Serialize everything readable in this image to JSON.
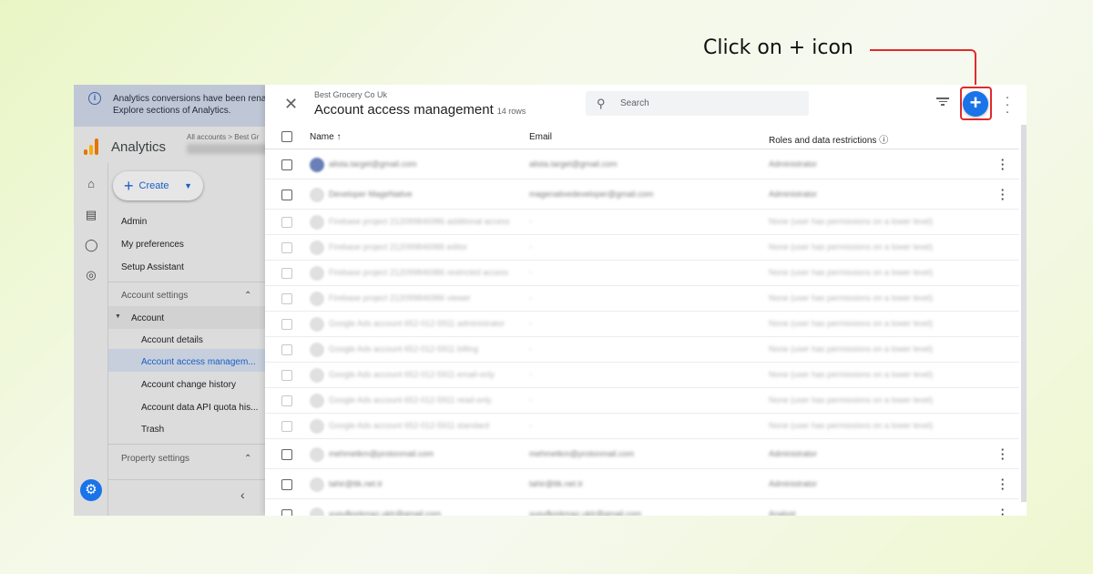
{
  "callout": {
    "text": "Click on + icon",
    "accent": "#e02b2b"
  },
  "ga": {
    "banner_line1": "Analytics conversions have been renam",
    "banner_line2": "Explore sections of Analytics.",
    "brand": "Analytics",
    "breadcrumb": "All accounts > Best Gr",
    "create_label": "Create",
    "nav": {
      "admin": "Admin",
      "my_preferences": "My preferences",
      "setup_assistant": "Setup Assistant",
      "account_settings": "Account settings",
      "account": "Account",
      "account_details": "Account details",
      "account_access": "Account access managem...",
      "account_change_history": "Account change history",
      "account_data_api": "Account data API quota his...",
      "trash": "Trash",
      "property_settings": "Property settings"
    },
    "rail_icons": [
      "home-icon",
      "reports-icon",
      "explore-icon",
      "advertising-icon"
    ],
    "settings_icon": "gear-icon"
  },
  "panel": {
    "account_name": "Best Grocery Co Uk",
    "title": "Account access management",
    "row_count": "14 rows",
    "search_placeholder": "Search",
    "columns": {
      "name": "Name",
      "email": "Email",
      "roles": "Roles and data restrictions"
    },
    "accent": "#1a73e8",
    "rows": [
      {
        "name": "alista.target@gmail.com",
        "email": "alista.target@gmail.com",
        "role": "Administrator",
        "menu": true,
        "dim": false
      },
      {
        "name": "Developer MageNative",
        "email": "magenativedeveloper@gmail.com",
        "role": "Administrator",
        "menu": true,
        "dim": false
      },
      {
        "name": "Firebase project 212099846986 additional access",
        "email": "-",
        "role": "None (user has permissions on a lower level)",
        "menu": false,
        "dim": true
      },
      {
        "name": "Firebase project 212099846986 editor",
        "email": "-",
        "role": "None (user has permissions on a lower level)",
        "menu": false,
        "dim": true
      },
      {
        "name": "Firebase project 212099846986 restricted access",
        "email": "-",
        "role": "None (user has permissions on a lower level)",
        "menu": false,
        "dim": true
      },
      {
        "name": "Firebase project 212099846986 viewer",
        "email": "-",
        "role": "None (user has permissions on a lower level)",
        "menu": false,
        "dim": true
      },
      {
        "name": "Google Ads account 652-012-5911 administrator",
        "email": "-",
        "role": "None (user has permissions on a lower level)",
        "menu": false,
        "dim": true
      },
      {
        "name": "Google Ads account 652-012-5911 billing",
        "email": "-",
        "role": "None (user has permissions on a lower level)",
        "menu": false,
        "dim": true
      },
      {
        "name": "Google Ads account 652-012-5911 email-only",
        "email": "-",
        "role": "None (user has permissions on a lower level)",
        "menu": false,
        "dim": true
      },
      {
        "name": "Google Ads account 652-012-5911 read-only",
        "email": "-",
        "role": "None (user has permissions on a lower level)",
        "menu": false,
        "dim": true
      },
      {
        "name": "Google Ads account 652-012-5911 standard",
        "email": "-",
        "role": "None (user has permissions on a lower level)",
        "menu": false,
        "dim": true
      },
      {
        "name": "mehmetkm@protonmail.com",
        "email": "mehmetkm@protonmail.com",
        "role": "Administrator",
        "menu": true,
        "dim": false
      },
      {
        "name": "tahir@ttk.net.tr",
        "email": "tahir@ttk.net.tr",
        "role": "Administrator",
        "menu": true,
        "dim": false
      },
      {
        "name": "yusufkorkmaz.uktr@gmail.com",
        "email": "yusufkorkmaz.uktr@gmail.com",
        "role": "Analyst",
        "menu": true,
        "dim": false
      }
    ]
  }
}
